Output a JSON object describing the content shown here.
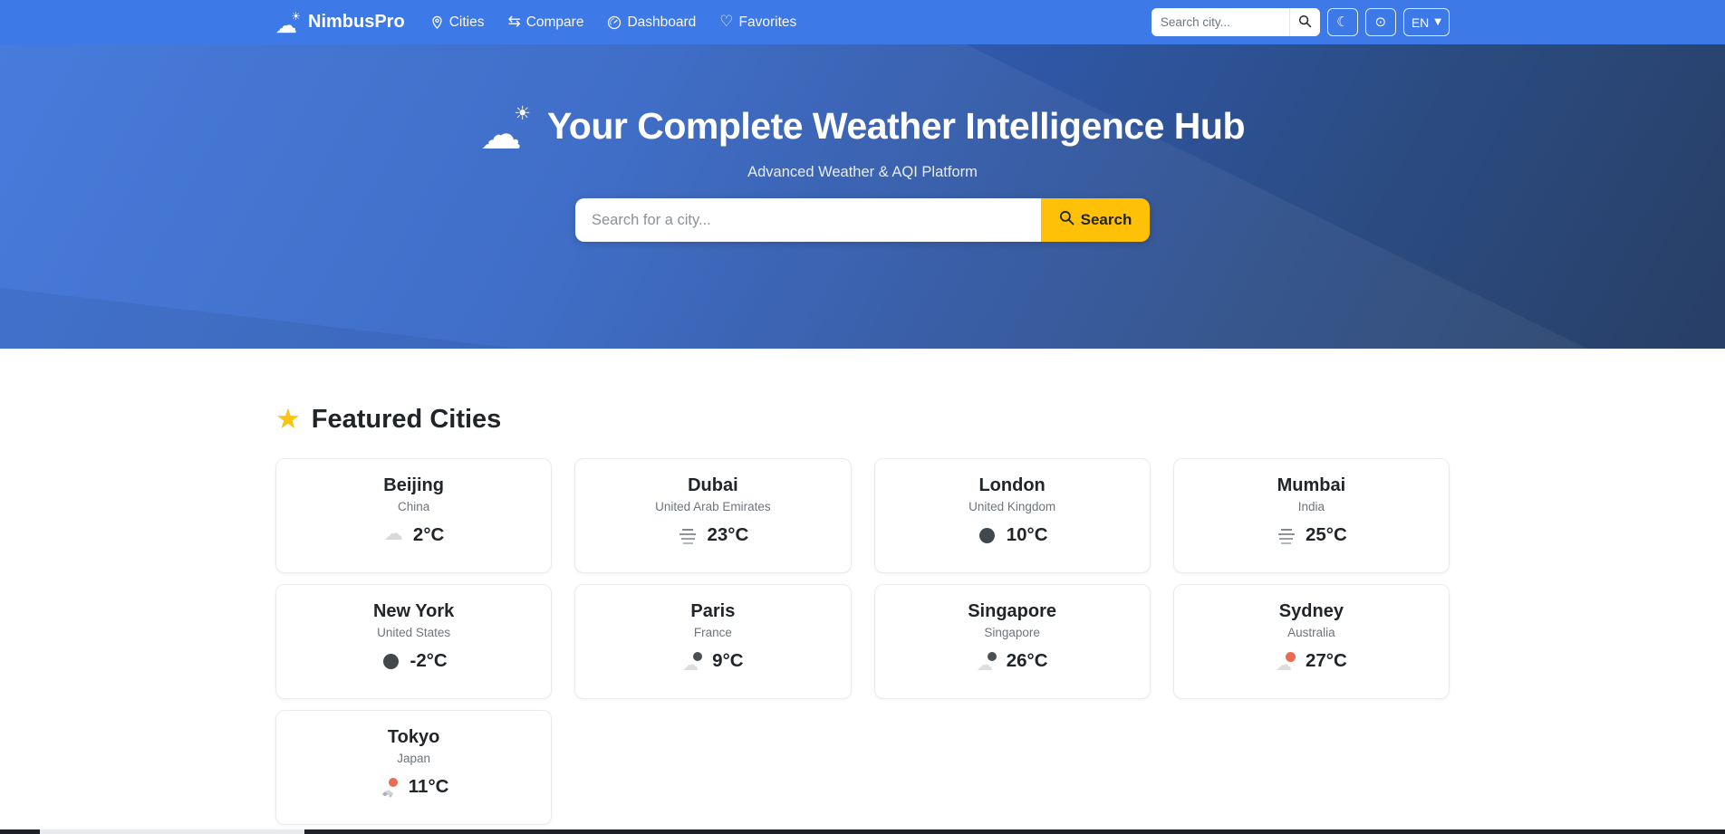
{
  "navbar": {
    "brand": "NimbusPro",
    "links": [
      {
        "icon": "pin-icon",
        "label": "Cities"
      },
      {
        "icon": "compare-icon",
        "label": "Compare"
      },
      {
        "icon": "dashboard-icon",
        "label": "Dashboard"
      },
      {
        "icon": "heart-icon",
        "label": "Favorites"
      }
    ],
    "search_placeholder": "Search city...",
    "lang_label": "EN"
  },
  "hero": {
    "title": "Your Complete Weather Intelligence Hub",
    "subtitle": "Advanced Weather & AQI Platform",
    "search_placeholder": "Search for a city...",
    "search_button": "Search"
  },
  "featured": {
    "heading": "Featured Cities",
    "cities": [
      {
        "name": "Beijing",
        "country": "China",
        "temp": "2°C",
        "icon": "cloud"
      },
      {
        "name": "Dubai",
        "country": "United Arab Emirates",
        "temp": "23°C",
        "icon": "fog"
      },
      {
        "name": "London",
        "country": "United Kingdom",
        "temp": "10°C",
        "icon": "moon"
      },
      {
        "name": "Mumbai",
        "country": "India",
        "temp": "25°C",
        "icon": "fog"
      },
      {
        "name": "New York",
        "country": "United States",
        "temp": "-2°C",
        "icon": "moon"
      },
      {
        "name": "Paris",
        "country": "France",
        "temp": "9°C",
        "icon": "cloud-moon"
      },
      {
        "name": "Singapore",
        "country": "Singapore",
        "temp": "26°C",
        "icon": "cloud-moon"
      },
      {
        "name": "Sydney",
        "country": "Australia",
        "temp": "27°C",
        "icon": "cloud-sun"
      },
      {
        "name": "Tokyo",
        "country": "Japan",
        "temp": "11°C",
        "icon": "cloud-sun-dots"
      }
    ]
  },
  "colors": {
    "navbar_blue": "#3e79e8",
    "hero_gradient_start": "#3e74da",
    "hero_gradient_end": "#283f66",
    "accent_yellow": "#ffc107",
    "star_gold": "#fcc30c",
    "text_dark": "#212529",
    "text_muted": "#6c757d"
  }
}
